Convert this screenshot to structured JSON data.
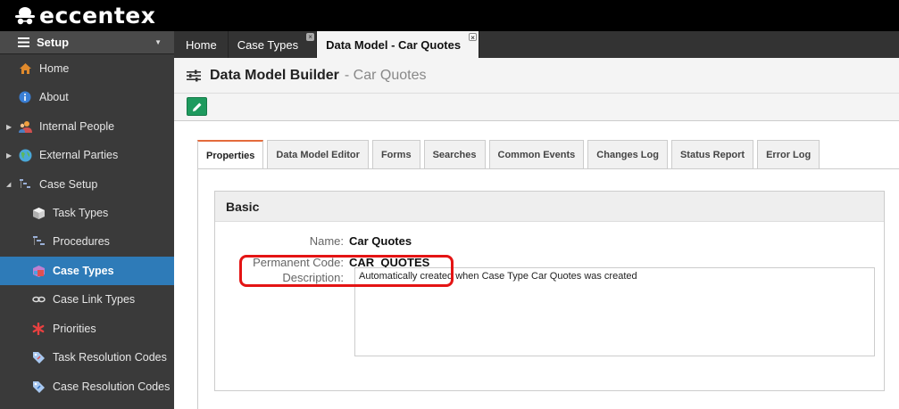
{
  "brand": {
    "name": "eccentex"
  },
  "sidebar": {
    "header": "Setup",
    "items": [
      {
        "label": "Home",
        "icon": "home-icon"
      },
      {
        "label": "About",
        "icon": "info-icon"
      },
      {
        "label": "Internal People",
        "icon": "people-icon"
      },
      {
        "label": "External Parties",
        "icon": "globe-icon"
      },
      {
        "label": "Case Setup",
        "icon": "case-setup-icon"
      },
      {
        "label": "Task Types",
        "icon": "cube-icon"
      },
      {
        "label": "Procedures",
        "icon": "procedure-icon"
      },
      {
        "label": "Case Types",
        "icon": "case-types-icon"
      },
      {
        "label": "Case Link Types",
        "icon": "link-icon"
      },
      {
        "label": "Priorities",
        "icon": "asterisk-icon"
      },
      {
        "label": "Task Resolution Codes",
        "icon": "tag-icon"
      },
      {
        "label": "Case Resolution Codes",
        "icon": "tag-icon"
      }
    ]
  },
  "tabs": [
    {
      "label": "Home"
    },
    {
      "label": "Case Types"
    },
    {
      "label": "Data Model - Car Quotes"
    }
  ],
  "header": {
    "title": "Data Model Builder",
    "subtitle": "- Car Quotes"
  },
  "subtabs": [
    "Properties",
    "Data Model Editor",
    "Forms",
    "Searches",
    "Common Events",
    "Changes Log",
    "Status Report",
    "Error Log"
  ],
  "basic": {
    "title": "Basic",
    "name_label": "Name:",
    "name_value": "Car Quotes",
    "code_label": "Permanent Code:",
    "code_value": "CAR_QUOTES",
    "desc_label": "Description:",
    "desc_value": "Automatically created when Case Type Car Quotes was created"
  },
  "colors": {
    "active_nav": "#2e7bb8",
    "edit_button": "#1e9a5e",
    "highlight": "#e41414",
    "active_tab_accent": "#e46b3c"
  }
}
